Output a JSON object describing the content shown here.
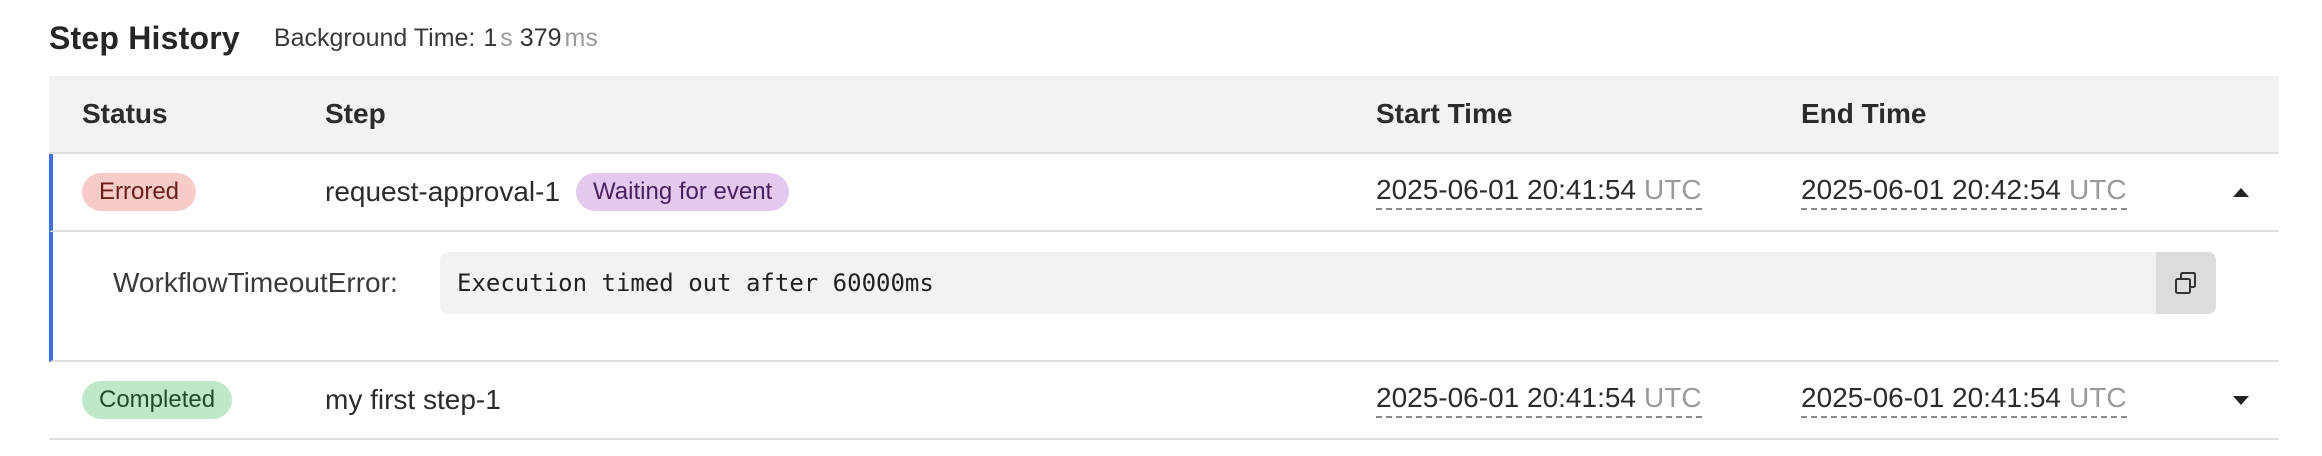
{
  "header": {
    "title": "Step History",
    "background_time_label": "Background Time:",
    "background_time_seconds": "1",
    "seconds_unit": "s",
    "background_time_ms": "379",
    "ms_unit": "ms"
  },
  "table": {
    "columns": [
      "Status",
      "Step",
      "Start Time",
      "End Time"
    ],
    "rows": [
      {
        "status": "Errored",
        "step": "request-approval-1",
        "tag": "Waiting for event",
        "start_time": "2025-06-01 20:41:54",
        "start_tz": "UTC",
        "end_time": "2025-06-01 20:42:54",
        "end_tz": "UTC",
        "expanded": true,
        "error_type": "WorkflowTimeoutError:",
        "error_message": "Execution timed out after 60000ms"
      },
      {
        "status": "Completed",
        "step": "my first step-1",
        "start_time": "2025-06-01 20:41:54",
        "start_tz": "UTC",
        "end_time": "2025-06-01 20:41:54",
        "end_tz": "UTC",
        "expanded": false
      }
    ]
  },
  "colors": {
    "accent": "#3f6fe0",
    "errored_bg": "#f7cbc8",
    "completed_bg": "#bfe8c8",
    "waiting_bg": "#e4c8ee"
  },
  "icons": {
    "copy": "copy-icon",
    "collapse": "caret-up-icon",
    "expand": "caret-down-icon"
  }
}
